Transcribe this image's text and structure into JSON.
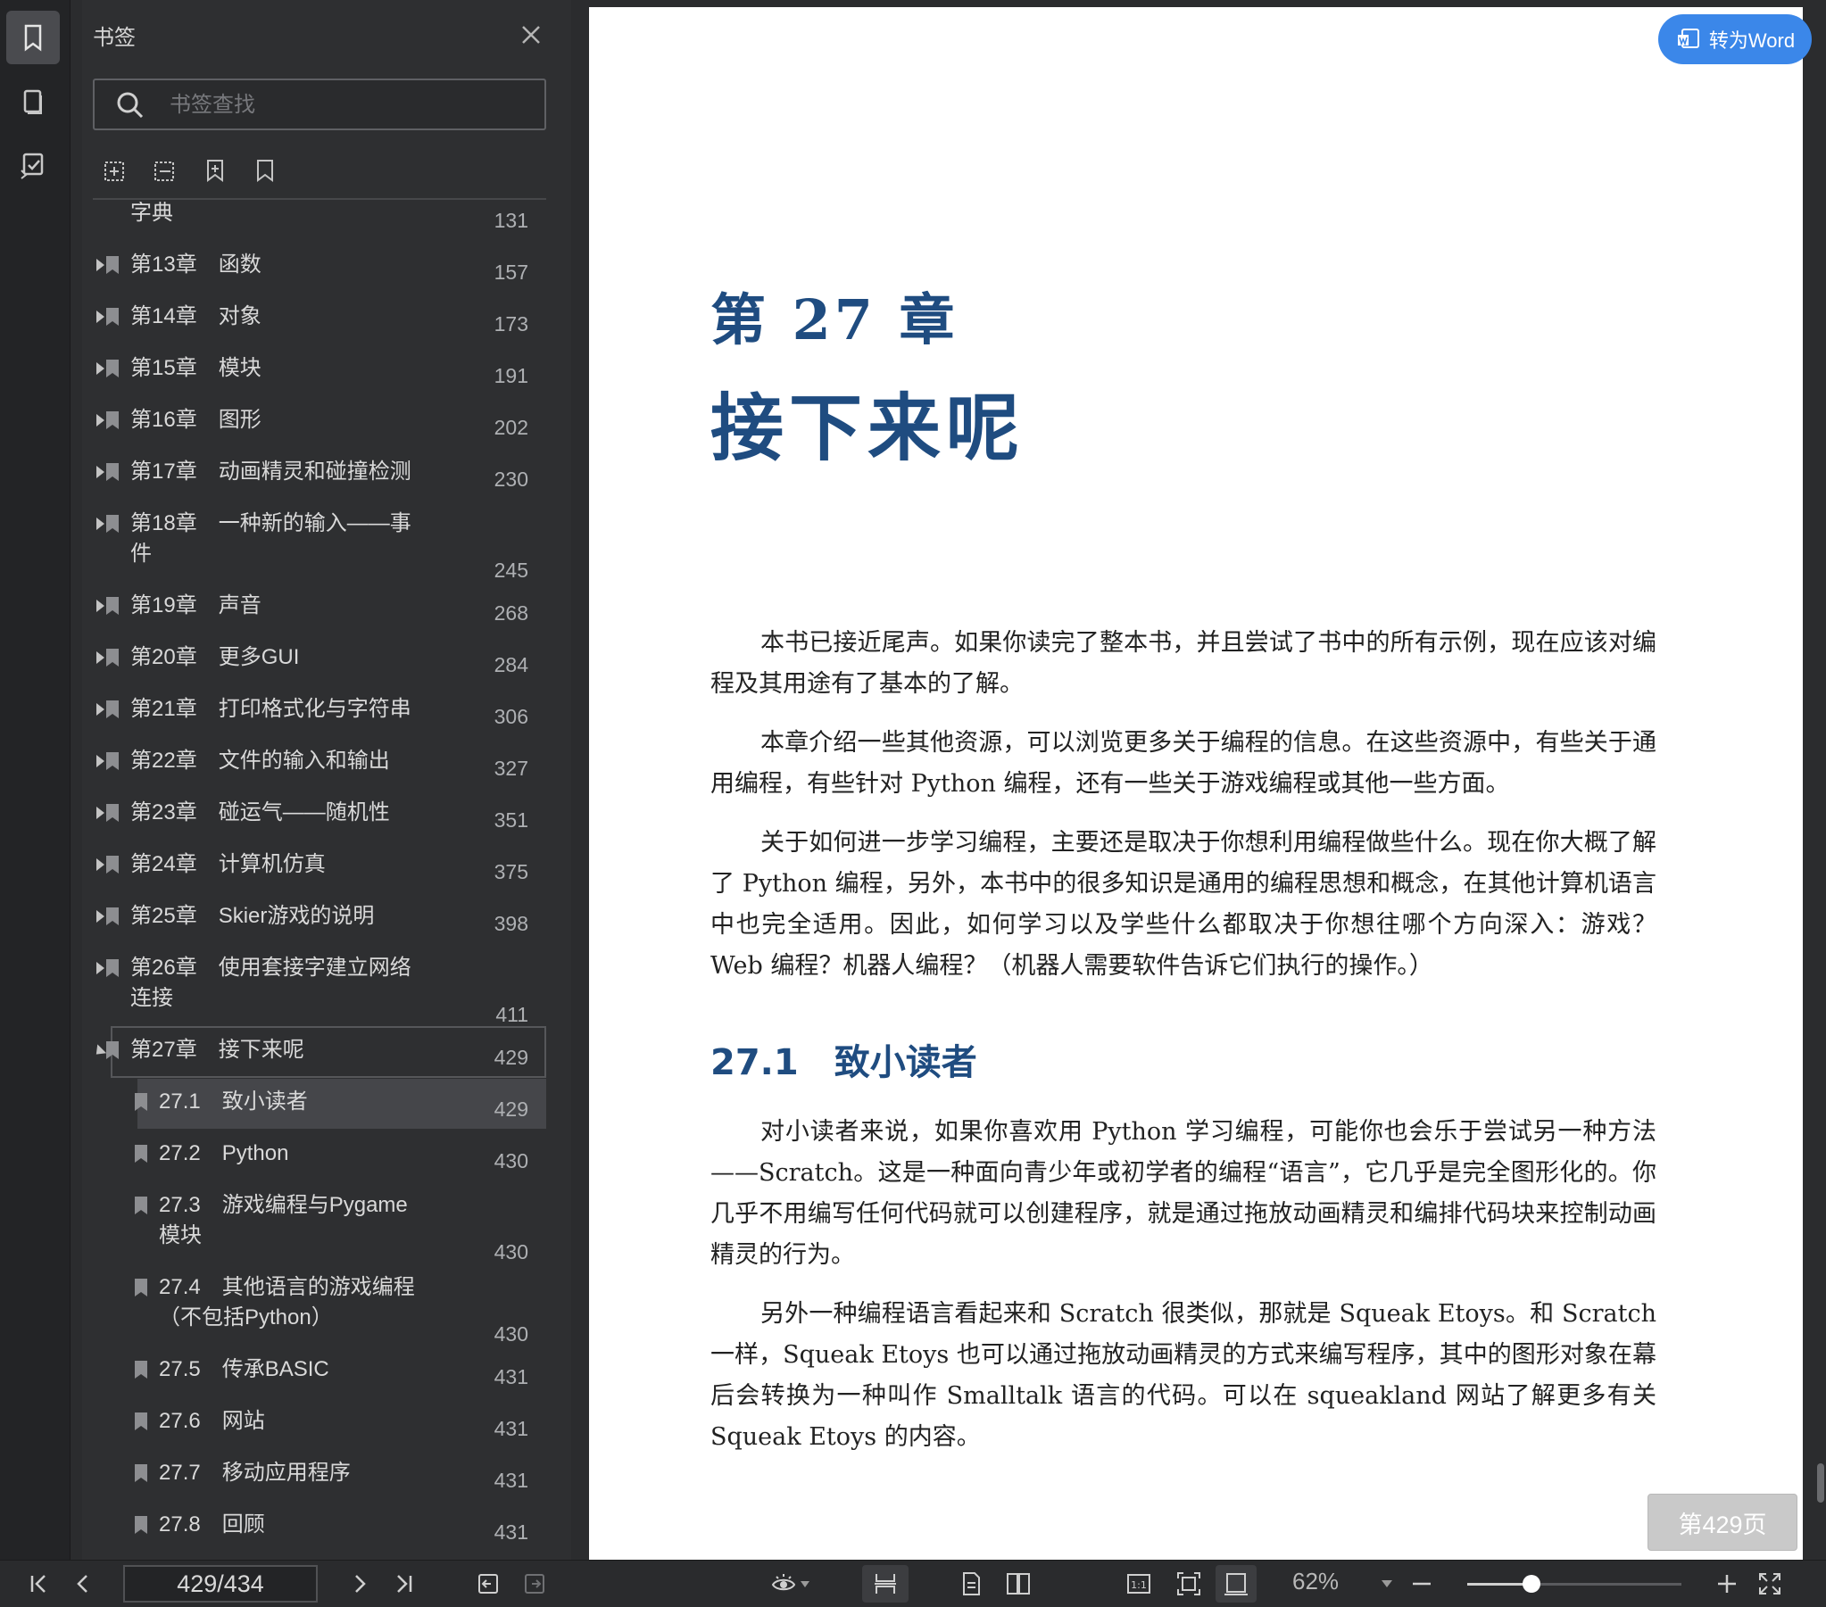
{
  "sidebar": {
    "title": "书签",
    "search_placeholder": "书签查找",
    "rail_icons": [
      "bookmark-icon",
      "page-thumbnail-icon",
      "annotation-icon"
    ],
    "toolbar_icons": [
      "add-bookmark-icon",
      "remove-bookmark-icon",
      "bookmark-add-sub-icon",
      "bookmark-icon"
    ],
    "items": [
      {
        "label": "字典",
        "page": "131",
        "level": 0,
        "arrow": false
      },
      {
        "label": "第13章　函数",
        "page": "157",
        "level": 0,
        "arrow": true
      },
      {
        "label": "第14章　对象",
        "page": "173",
        "level": 0,
        "arrow": true
      },
      {
        "label": "第15章　模块",
        "page": "191",
        "level": 0,
        "arrow": true
      },
      {
        "label": "第16章　图形",
        "page": "202",
        "level": 0,
        "arrow": true
      },
      {
        "label": "第17章　动画精灵和碰撞检测",
        "page": "230",
        "level": 0,
        "arrow": true
      },
      {
        "label": "第18章　一种新的输入——事\n件",
        "page": "245",
        "level": 0,
        "arrow": true
      },
      {
        "label": "第19章　声音",
        "page": "268",
        "level": 0,
        "arrow": true
      },
      {
        "label": "第20章　更多GUI",
        "page": "284",
        "level": 0,
        "arrow": true
      },
      {
        "label": "第21章　打印格式化与字符串",
        "page": "306",
        "level": 0,
        "arrow": true
      },
      {
        "label": "第22章　文件的输入和输出",
        "page": "327",
        "level": 0,
        "arrow": true
      },
      {
        "label": "第23章　碰运气——随机性",
        "page": "351",
        "level": 0,
        "arrow": true
      },
      {
        "label": "第24章　计算机仿真",
        "page": "375",
        "level": 0,
        "arrow": true
      },
      {
        "label": "第25章　Skier游戏的说明",
        "page": "398",
        "level": 0,
        "arrow": true
      },
      {
        "label": "第26章　使用套接字建立网络\n连接",
        "page": "411",
        "level": 0,
        "arrow": true
      },
      {
        "label": "第27章　接下来呢",
        "page": "429",
        "level": 0,
        "arrow": true,
        "open": true
      },
      {
        "label": "27.1　致小读者",
        "page": "429",
        "level": 1,
        "arrow": false,
        "current": true
      },
      {
        "label": "27.2　Python",
        "page": "430",
        "level": 1,
        "arrow": false
      },
      {
        "label": "27.3　游戏编程与Pygame\n模块",
        "page": "430",
        "level": 1,
        "arrow": false
      },
      {
        "label": "27.4　其他语言的游戏编程\n（不包括Python）",
        "page": "430",
        "level": 1,
        "arrow": false
      },
      {
        "label": "27.5　传承BASIC",
        "page": "431",
        "level": 1,
        "arrow": false
      },
      {
        "label": "27.6　网站",
        "page": "431",
        "level": 1,
        "arrow": false
      },
      {
        "label": "27.7　移动应用程序",
        "page": "431",
        "level": 1,
        "arrow": false
      },
      {
        "label": "27.8　回顾",
        "page": "431",
        "level": 1,
        "arrow": false
      }
    ]
  },
  "document": {
    "chapter_number": "第 27 章",
    "chapter_title": "接下来呢",
    "paragraphs": [
      "本书已接近尾声。如果你读完了整本书，并且尝试了书中的所有示例，现在应该对编程及其用途有了基本的了解。",
      "本章介绍一些其他资源，可以浏览更多关于编程的信息。在这些资源中，有些关于通用编程，有些针对 Python 编程，还有一些关于游戏编程或其他一些方面。",
      "关于如何进一步学习编程，主要还是取决于你想利用编程做些什么。现在你大概了解了 Python 编程，另外，本书中的很多知识是通用的编程思想和概念，在其他计算机语言中也完全适用。因此，如何学习以及学些什么都取决于你想往哪个方向深入：游戏？ Web 编程？机器人编程？（机器人需要软件告诉它们执行的操作。）"
    ],
    "section_heading": "27.1　致小读者",
    "section_paragraphs": [
      "对小读者来说，如果你喜欢用 Python 学习编程，可能你也会乐于尝试另一种方法——Scratch。这是一种面向青少年或初学者的编程“语言”，它几乎是完全图形化的。你几乎不用编写任何代码就可以创建程序，就是通过拖放动画精灵和编排代码块来控制动画精灵的行为。",
      "另外一种编程语言看起来和 Scratch 很类似，那就是 Squeak Etoys。和 Scratch 一样，Squeak Etoys 也可以通过拖放动画精灵的方式来编写程序，其中的图形对象在幕后会转换为一种叫作 Smalltalk 语言的代码。可以在 squeakland 网站了解更多有关 Squeak Etoys 的内容。"
    ],
    "to_word_label": "转为Word",
    "page_badge": "第429页"
  },
  "bottom_toolbar": {
    "page_indicator": "429/434",
    "zoom": "62%",
    "zoom_fraction": 0.3,
    "icons": [
      "first-page-icon",
      "prev-page-icon",
      "next-page-icon",
      "last-page-icon",
      "back-icon",
      "forward-icon",
      "eye-mode-icon",
      "continuous-scroll-icon",
      "single-page-icon",
      "two-page-icon",
      "actual-size-icon",
      "fit-page-icon",
      "fit-width-icon",
      "zoom-out-icon",
      "zoom-in-icon",
      "fullscreen-icon"
    ]
  },
  "colors": {
    "accent_blue": "#1f4c80",
    "word_button": "#3b87e9",
    "panel_bg": "#2e2f31"
  }
}
